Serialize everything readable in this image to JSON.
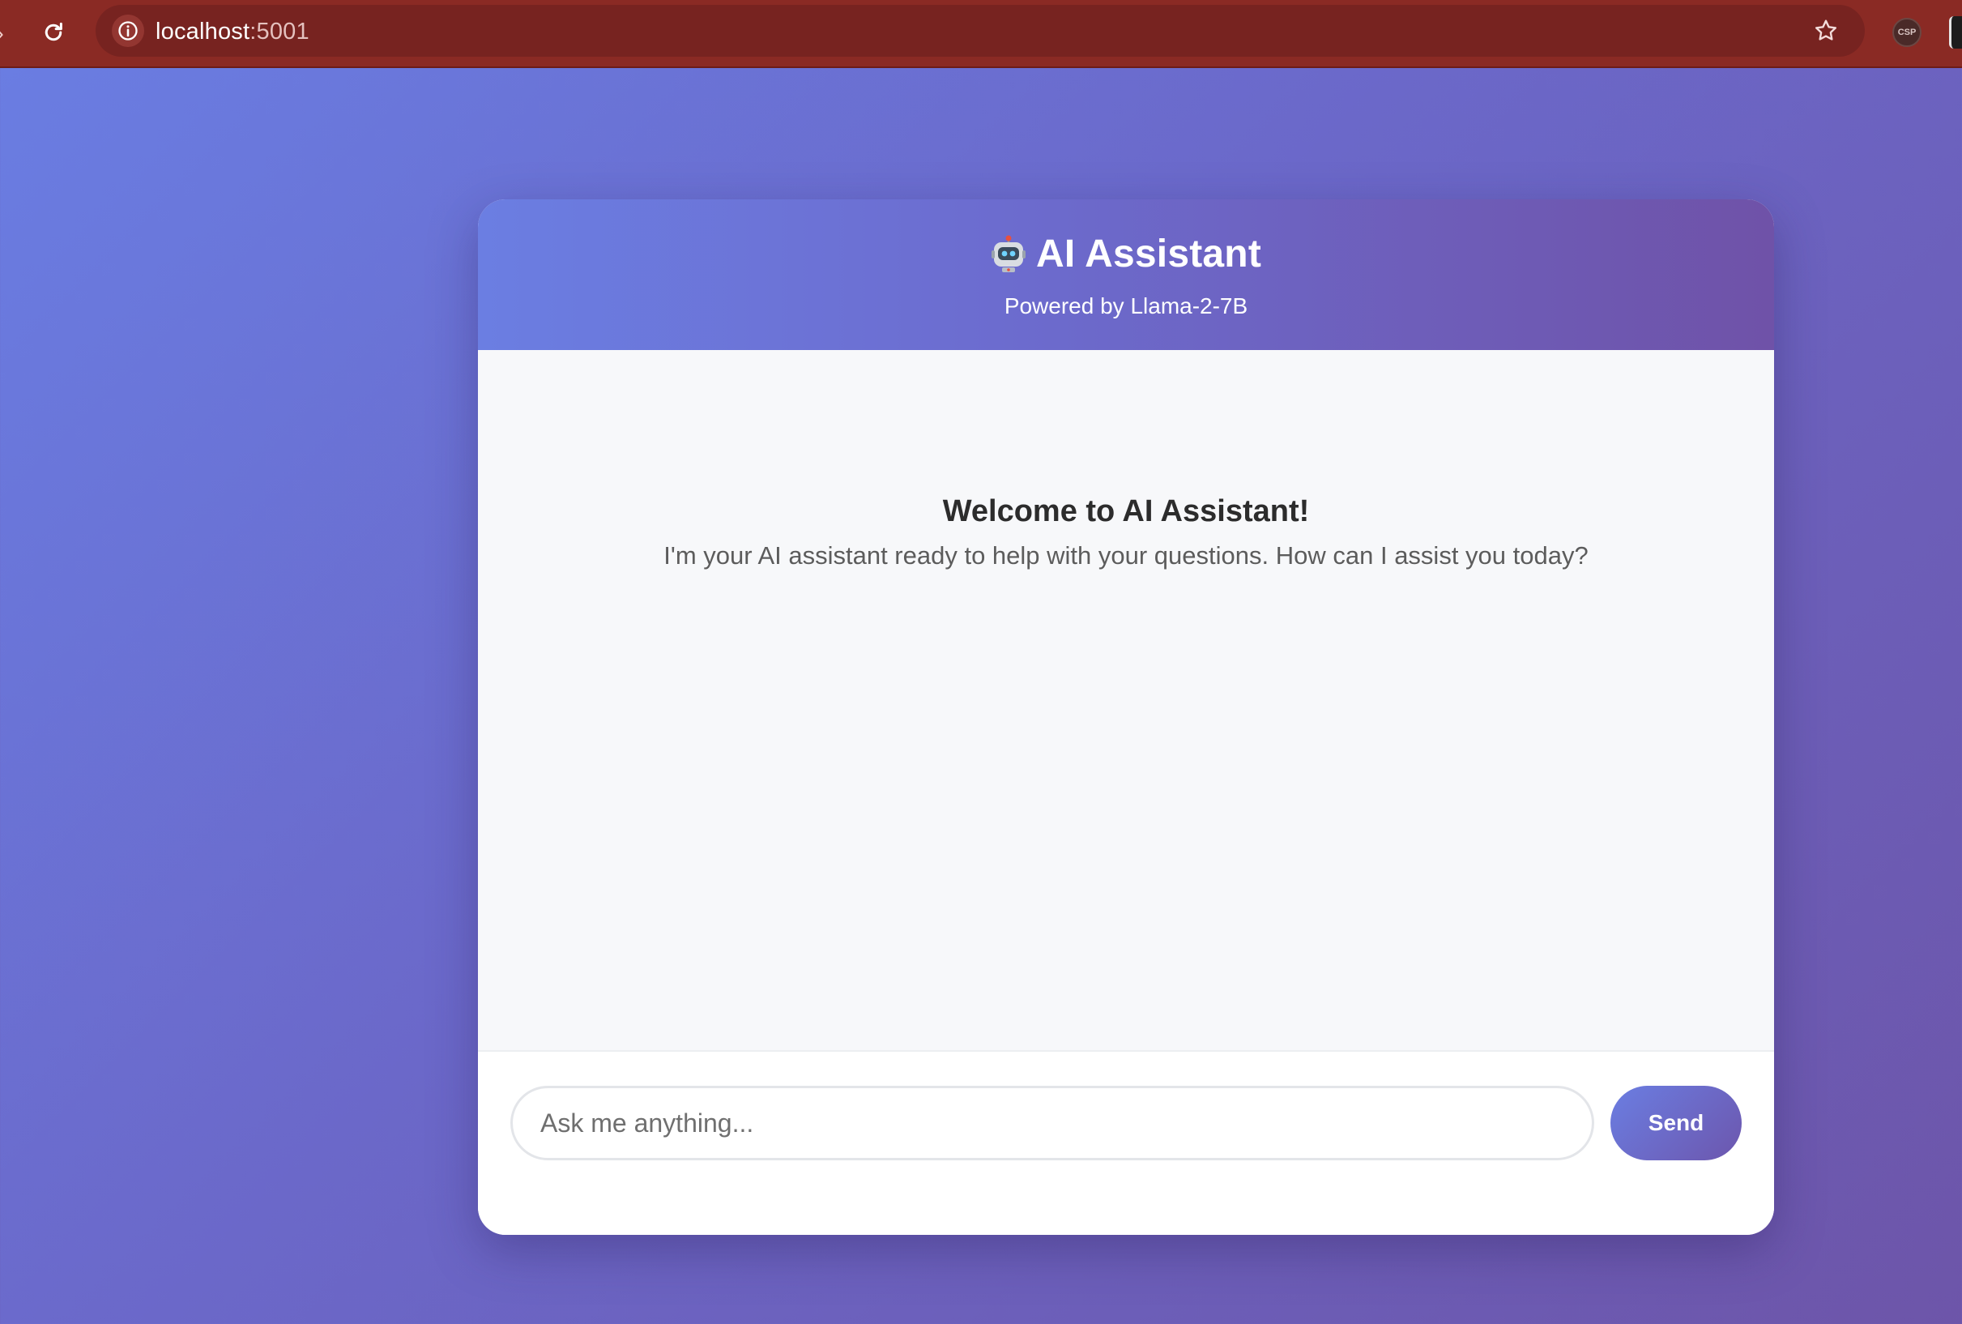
{
  "browser": {
    "url_host": "localhost",
    "url_port": ":5001",
    "extension_label": "CSP",
    "icons": {
      "reload": "reload-icon",
      "info": "info-icon",
      "bookmark": "star-icon"
    }
  },
  "header": {
    "title": "AI Assistant",
    "subtitle": "Powered by Llama-2-7B",
    "icon": "robot-icon"
  },
  "welcome": {
    "title": "Welcome to AI Assistant!",
    "text": "I'm your AI assistant ready to help with your questions. How can I assist you today?"
  },
  "input": {
    "placeholder": "Ask me anything...",
    "value": ""
  },
  "send": {
    "label": "Send"
  },
  "colors": {
    "background_start": "#6a7ee3",
    "background_end": "#6d55a9",
    "chrome": "#8a2a24",
    "header_start": "#6b7ee2",
    "header_end": "#6f52a8",
    "messages_bg": "#f7f8fa"
  }
}
